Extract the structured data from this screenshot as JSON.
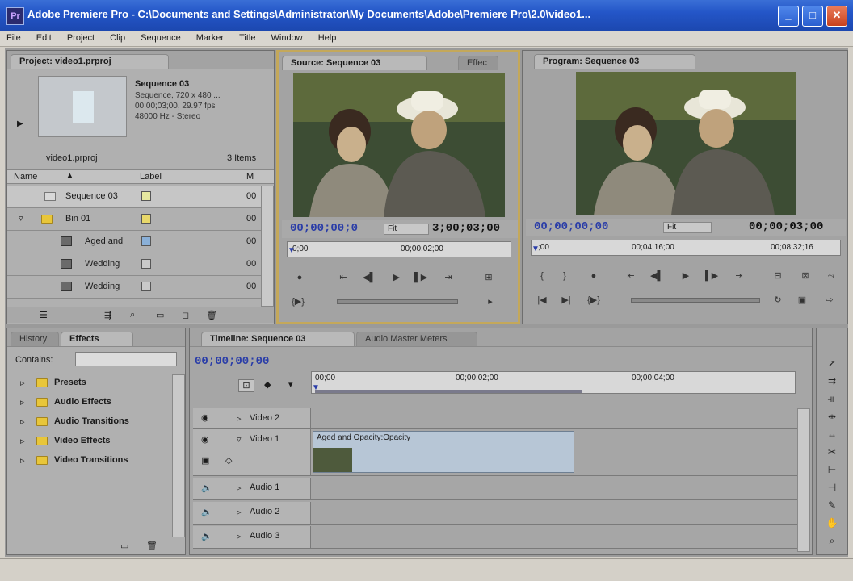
{
  "window": {
    "title": "Adobe Premiere Pro - C:\\Documents and Settings\\Administrator\\My Documents\\Adobe\\Premiere Pro\\2.0\\video1...",
    "icon": "Pr",
    "buttons": {
      "minimize": "_",
      "maximize": "□",
      "close": "✕"
    }
  },
  "menu": [
    "File",
    "Edit",
    "Project",
    "Clip",
    "Sequence",
    "Marker",
    "Title",
    "Window",
    "Help"
  ],
  "project": {
    "tab": "Project: video1.prproj",
    "preview": {
      "name": "Sequence 03",
      "line1": "Sequence, 720 x 480 ...",
      "line2": "00;00;03;00, 29.97 fps",
      "line3": "48000 Hz - Stereo"
    },
    "file": "video1.prproj",
    "items_count": "3 Items",
    "columns": {
      "name": "Name",
      "label": "Label",
      "media": "M"
    },
    "items": [
      {
        "name": "Sequence 03",
        "label_color": "#e6e8a0",
        "media": "00"
      },
      {
        "name": "Bin 01",
        "label_color": "#e8d86a",
        "media": "00"
      },
      {
        "name": "Aged and",
        "label_color": "#8ab0d8",
        "media": "00"
      },
      {
        "name": "Wedding",
        "label_color": "#c9c9c9",
        "media": "00"
      },
      {
        "name": "Wedding",
        "label_color": "#c9c9c9",
        "media": "00"
      }
    ]
  },
  "source": {
    "tab": "Source: Sequence 03",
    "tab2": "Effec",
    "timecode_in": "00;00;00;0",
    "fit": "Fit",
    "timecode_dur": "3;00;03;00",
    "ruler": [
      "0;00",
      "00;00;02;00"
    ]
  },
  "program": {
    "tab": "Program: Sequence 03",
    "timecode_in": "00;00;00;00",
    "fit": "Fit",
    "timecode_dur": "00;00;03;00",
    "ruler": [
      ";00",
      "00;04;16;00",
      "00;08;32;16"
    ]
  },
  "effects_panel": {
    "tab_history": "History",
    "tab_effects": "Effects",
    "contains_label": "Contains:",
    "folders": [
      "Presets",
      "Audio Effects",
      "Audio Transitions",
      "Video Effects",
      "Video Transitions"
    ]
  },
  "timeline": {
    "tab": "Timeline: Sequence 03",
    "tab2": "Audio Master Meters",
    "timecode": "00;00;00;00",
    "ruler": [
      "00;00",
      "00;00;02;00",
      "00;00;04;00"
    ],
    "tracks": [
      {
        "name": "Video 2"
      },
      {
        "name": "Video 1",
        "clip": "Aged and Opacity:Opacity"
      },
      {
        "name": "Audio 1"
      },
      {
        "name": "Audio 2"
      },
      {
        "name": "Audio 3"
      }
    ]
  },
  "tools": [
    "selection-tool",
    "track-select-tool",
    "ripple-edit-tool",
    "rolling-edit-tool",
    "rate-stretch-tool",
    "razor-tool",
    "slip-tool",
    "slide-tool",
    "pen-tool",
    "hand-tool",
    "zoom-tool"
  ]
}
